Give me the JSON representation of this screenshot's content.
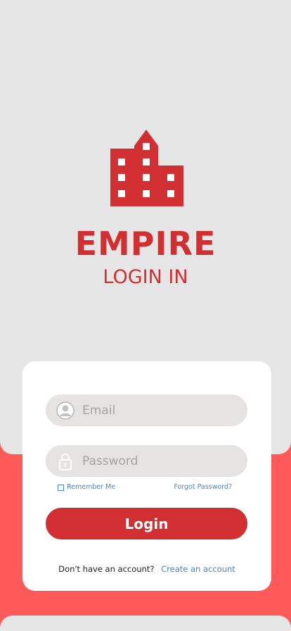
{
  "brand": {
    "name": "EMPIRE",
    "subtitle": "LOGIN IN",
    "logo_icon": "building-icon",
    "accent_color": "#d22f32"
  },
  "form": {
    "email_placeholder": "Email",
    "email_value": "",
    "email_icon": "user-icon",
    "password_placeholder": "Password",
    "password_value": "",
    "password_icon": "lock-icon",
    "remember_label": "Remember Me",
    "remember_checked": false,
    "forgot_label": "Forgot Password?",
    "login_label": "Login",
    "signup_prompt": "Don't have an account?",
    "signup_link": "Create an account"
  },
  "colors": {
    "background_top": "#e6e6e6",
    "background_bottom": "#ff5a5a",
    "link": "#4a86c8",
    "input_bg": "#e6e3e3"
  }
}
